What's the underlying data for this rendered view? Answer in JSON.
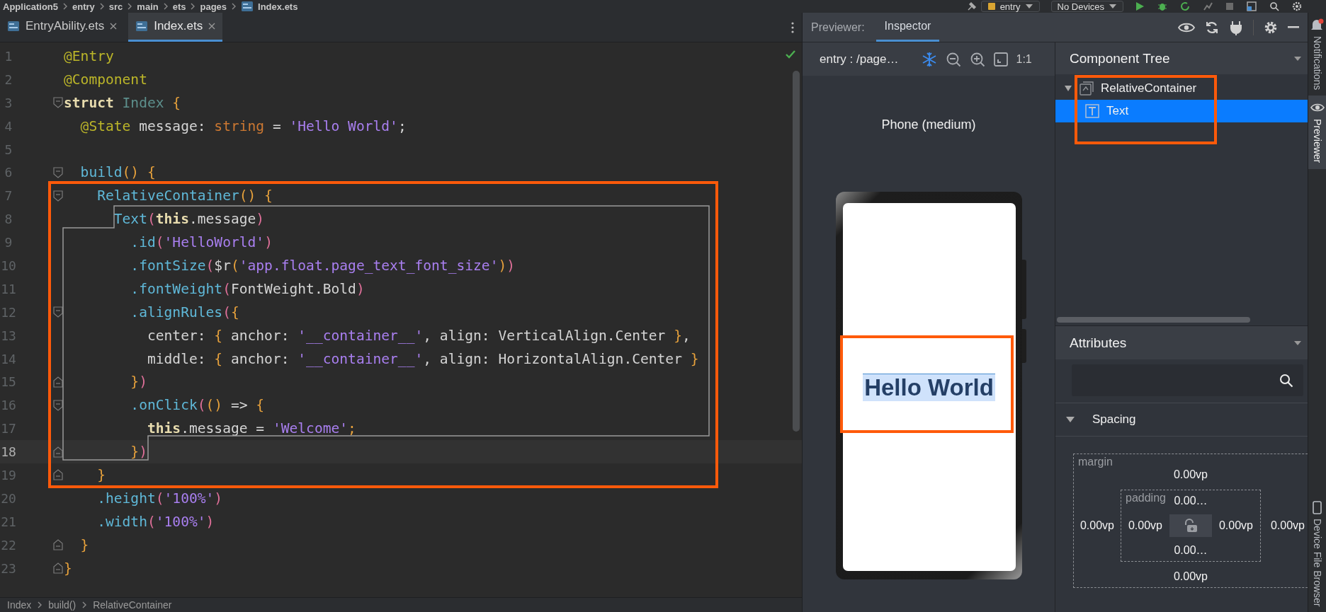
{
  "breadcrumb": [
    "Application5",
    "entry",
    "src",
    "main",
    "ets",
    "pages",
    "Index.ets"
  ],
  "run_config": {
    "module": "entry",
    "device": "No Devices"
  },
  "editor_tabs": [
    {
      "label": "EntryAbility.ets",
      "selected": false
    },
    {
      "label": "Index.ets",
      "selected": true
    }
  ],
  "code_lines": [
    {
      "number": "1",
      "current": false,
      "kind": "plain",
      "tokens": [
        {
          "kind": "annotation",
          "text": "@Entry"
        }
      ]
    },
    {
      "number": "2",
      "current": false,
      "kind": "plain",
      "tokens": [
        {
          "kind": "annotation",
          "text": "@Component"
        }
      ]
    },
    {
      "number": "3",
      "current": false,
      "kind": "opener",
      "tokens": [
        {
          "kind": "keyword",
          "text": "struct"
        },
        {
          "kind": "class",
          "text": " Index"
        },
        {
          "kind": "brace",
          "text": " {"
        }
      ]
    },
    {
      "number": "4",
      "current": false,
      "kind": "plain",
      "tokens": [
        {
          "kind": "annotation",
          "text": "  @State"
        },
        {
          "kind": "plain",
          "text": " message: "
        },
        {
          "kind": "type",
          "text": "string"
        },
        {
          "kind": "plain",
          "text": " = "
        },
        {
          "kind": "string",
          "text": "'Hello World'"
        },
        {
          "kind": "plain",
          "text": ";"
        }
      ]
    },
    {
      "number": "5",
      "current": false,
      "kind": "plain"
    },
    {
      "number": "6",
      "current": false,
      "kind": "opener",
      "tokens": [
        {
          "kind": "function",
          "text": "  build"
        },
        {
          "kind": "brace",
          "text": "()"
        },
        {
          "kind": "brace",
          "text": " {"
        }
      ]
    },
    {
      "number": "7",
      "current": false,
      "kind": "opener",
      "tokens": [
        {
          "kind": "function",
          "text": "    RelativeContainer"
        },
        {
          "kind": "brace",
          "text": "()"
        },
        {
          "kind": "brace",
          "text": " {"
        }
      ]
    },
    {
      "number": "8",
      "current": false,
      "kind": "plain",
      "tokens": [
        {
          "kind": "function",
          "text": "      Text"
        },
        {
          "kind": "paren",
          "text": "("
        },
        {
          "kind": "keyword",
          "text": "this"
        },
        {
          "kind": "plain",
          "text": ".message"
        },
        {
          "kind": "paren",
          "text": ")"
        }
      ]
    },
    {
      "number": "9",
      "current": false,
      "kind": "plain",
      "tokens": [
        {
          "kind": "function",
          "text": "        .id"
        },
        {
          "kind": "paren",
          "text": "("
        },
        {
          "kind": "string",
          "text": "'HelloWorld'"
        },
        {
          "kind": "paren",
          "text": ")"
        }
      ]
    },
    {
      "number": "10",
      "current": false,
      "kind": "plain",
      "tokens": [
        {
          "kind": "function",
          "text": "        .fontSize"
        },
        {
          "kind": "paren",
          "text": "("
        },
        {
          "kind": "plain",
          "text": "$r"
        },
        {
          "kind": "brace",
          "text": "("
        },
        {
          "kind": "string",
          "text": "'app.float.page_text_font_size'"
        },
        {
          "kind": "brace",
          "text": ")"
        },
        {
          "kind": "paren",
          "text": ")"
        }
      ]
    },
    {
      "number": "11",
      "current": false,
      "kind": "plain",
      "tokens": [
        {
          "kind": "function",
          "text": "        .fontWeight"
        },
        {
          "kind": "paren",
          "text": "("
        },
        {
          "kind": "plain",
          "text": "FontWeight.Bold"
        },
        {
          "kind": "paren",
          "text": ")"
        }
      ]
    },
    {
      "number": "12",
      "current": false,
      "kind": "opener",
      "tokens": [
        {
          "kind": "function",
          "text": "        .alignRules"
        },
        {
          "kind": "paren",
          "text": "("
        },
        {
          "kind": "brace",
          "text": "{"
        }
      ]
    },
    {
      "number": "13",
      "current": false,
      "kind": "plain",
      "tokens": [
        {
          "kind": "plain",
          "text": "          center: "
        },
        {
          "kind": "brace",
          "text": "{"
        },
        {
          "kind": "plain",
          "text": " anchor: "
        },
        {
          "kind": "string",
          "text": "'__container__'"
        },
        {
          "kind": "plain",
          "text": ", align: VerticalAlign.Center "
        },
        {
          "kind": "brace",
          "text": "}"
        },
        {
          "kind": "plain",
          "text": ","
        }
      ]
    },
    {
      "number": "14",
      "current": false,
      "kind": "plain",
      "tokens": [
        {
          "kind": "plain",
          "text": "          middle: "
        },
        {
          "kind": "brace",
          "text": "{"
        },
        {
          "kind": "plain",
          "text": " anchor: "
        },
        {
          "kind": "string",
          "text": "'__container__'"
        },
        {
          "kind": "plain",
          "text": ", align: HorizontalAlign.Center "
        },
        {
          "kind": "brace",
          "text": "}"
        }
      ]
    },
    {
      "number": "15",
      "current": false,
      "kind": "closer",
      "tokens": [
        {
          "kind": "brace",
          "text": "        }"
        },
        {
          "kind": "paren",
          "text": ")"
        }
      ]
    },
    {
      "number": "16",
      "current": false,
      "kind": "opener",
      "tokens": [
        {
          "kind": "function",
          "text": "        .onClick"
        },
        {
          "kind": "paren",
          "text": "("
        },
        {
          "kind": "brace",
          "text": "()"
        },
        {
          "kind": "plain",
          "text": " => "
        },
        {
          "kind": "brace",
          "text": "{"
        }
      ]
    },
    {
      "number": "17",
      "current": false,
      "kind": "plain",
      "tokens": [
        {
          "kind": "keyword",
          "text": "          this"
        },
        {
          "kind": "plain",
          "text": ".message = "
        },
        {
          "kind": "string",
          "text": "'Welcome'"
        },
        {
          "kind": "brace",
          "text": ";"
        }
      ]
    },
    {
      "number": "18",
      "current": true,
      "kind": "closer",
      "tokens": [
        {
          "kind": "brace",
          "text": "        }"
        },
        {
          "kind": "paren",
          "text": ")"
        }
      ]
    },
    {
      "number": "19",
      "current": false,
      "kind": "closer",
      "tokens": [
        {
          "kind": "brace",
          "text": "    }"
        }
      ]
    },
    {
      "number": "20",
      "current": false,
      "kind": "plain",
      "tokens": [
        {
          "kind": "function",
          "text": "    .height"
        },
        {
          "kind": "paren",
          "text": "("
        },
        {
          "kind": "string",
          "text": "'100%'"
        },
        {
          "kind": "paren",
          "text": ")"
        }
      ]
    },
    {
      "number": "21",
      "current": false,
      "kind": "plain",
      "tokens": [
        {
          "kind": "function",
          "text": "    .width"
        },
        {
          "kind": "paren",
          "text": "("
        },
        {
          "kind": "string",
          "text": "'100%'"
        },
        {
          "kind": "paren",
          "text": ")"
        }
      ]
    },
    {
      "number": "22",
      "current": false,
      "kind": "closer",
      "tokens": [
        {
          "kind": "brace",
          "text": "  }"
        }
      ]
    },
    {
      "number": "23",
      "current": false,
      "kind": "closer",
      "tokens": [
        {
          "kind": "brace",
          "text": "}"
        }
      ]
    }
  ],
  "editor_breadcrumb": [
    "Index",
    "build()",
    "RelativeContainer"
  ],
  "tool_window": {
    "label": "Previewer:",
    "tabs": [
      {
        "label": "Inspector",
        "selected": true
      }
    ]
  },
  "previewer": {
    "page": "entry : /page…",
    "zoom_label": "1:1",
    "device": "Phone (medium)",
    "app_text": "Hello World"
  },
  "component_tree": {
    "title": "Component Tree",
    "nodes": [
      {
        "label": "RelativeContainer",
        "expanded": true,
        "selected": false,
        "children": [
          {
            "label": "Text",
            "selected": true
          }
        ]
      }
    ]
  },
  "attributes": {
    "title": "Attributes",
    "sections": [
      {
        "label": "Spacing",
        "expanded": true
      }
    ],
    "margin": {
      "label": "margin",
      "top": "0.00vp",
      "left": "0.00vp",
      "right": "0.00vp",
      "bottom": "0.00vp"
    },
    "padding": {
      "label": "padding",
      "top": "0.00…",
      "left": "0.00vp",
      "right": "0.00vp",
      "bottom": "0.00…"
    }
  },
  "side_tabs": [
    {
      "label": "Notifications",
      "selected": false
    },
    {
      "label": "Previewer",
      "selected": true
    },
    {
      "label": "Device File Browser",
      "selected": false
    }
  ]
}
